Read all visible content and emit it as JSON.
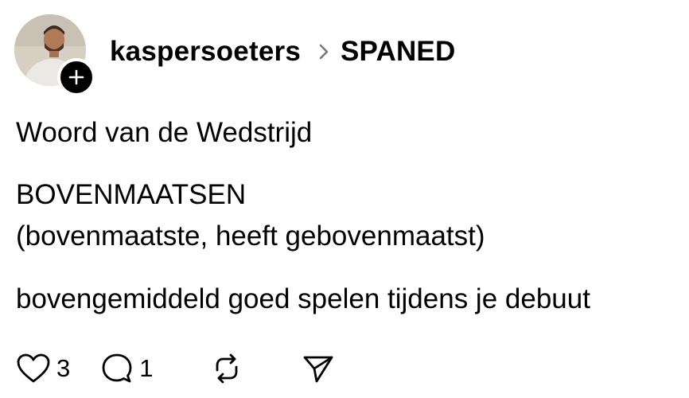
{
  "post": {
    "author": "kaspersoeters",
    "community": "SPANED",
    "lines": {
      "title": "Woord van de Wedstrijd",
      "word": "BOVENMAATSEN",
      "forms": "(bovenmaatste, heeft gebovenmaatst)",
      "definition": "bovengemiddeld goed spelen tijdens je debuut"
    }
  },
  "actions": {
    "like_icon": "heart-icon",
    "like_count": "3",
    "reply_icon": "comment-icon",
    "reply_count": "1",
    "repost_icon": "repost-icon",
    "share_icon": "send-icon"
  }
}
